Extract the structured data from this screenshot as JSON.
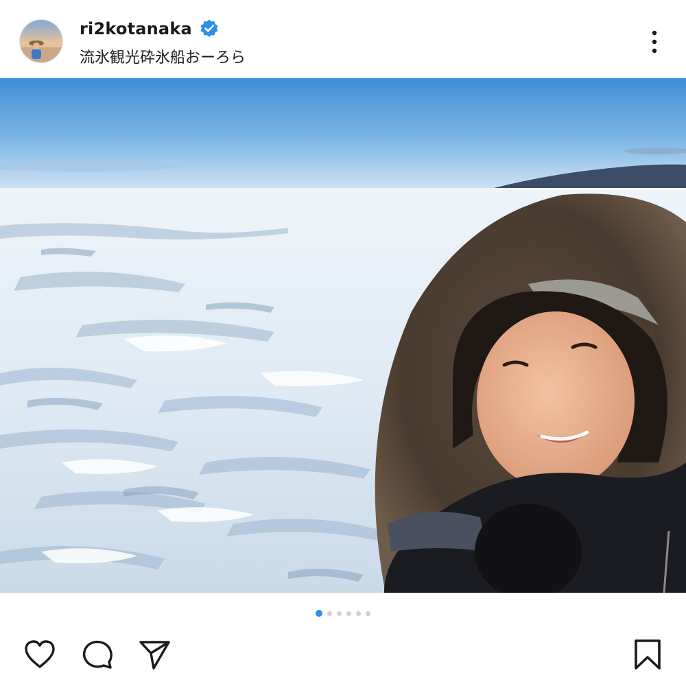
{
  "post": {
    "username": "ri2kotanaka",
    "verified": true,
    "location": "流氷観光砕氷船おーろら"
  },
  "carousel": {
    "total_slides": 6,
    "active_index": 0
  },
  "icons": {
    "avatar": "avatar-photo",
    "verified": "verified-badge-icon",
    "more": "more-options-icon",
    "like": "heart-icon",
    "comment": "comment-bubble-icon",
    "share": "send-paper-plane-icon",
    "save": "bookmark-icon"
  },
  "colors": {
    "verified_badge": "#2f8fe6",
    "active_dot": "#2f8fe6",
    "inactive_dot": "#d0d0d0",
    "icon_stroke": "#1a1a1a"
  }
}
